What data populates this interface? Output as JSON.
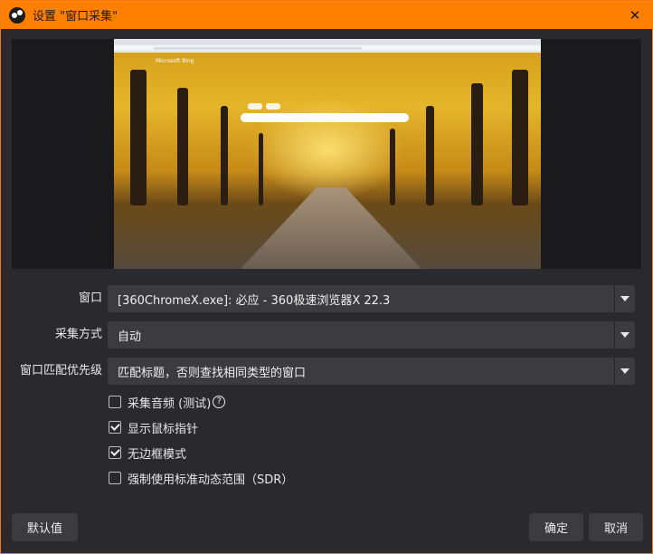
{
  "window": {
    "title": "设置 \"窗口采集\"",
    "close_glyph": "✕",
    "accent": "#ff7f00",
    "background": "#2a2a2e",
    "app_icon": "obs-icon"
  },
  "preview": {
    "browser_brand": "Microsoft Bing"
  },
  "fields": {
    "window": {
      "label": "窗口",
      "value": "[360ChromeX.exe]: 必应 - 360极速浏览器X 22.3"
    },
    "capture_method": {
      "label": "采集方式",
      "value": "自动"
    },
    "match_priority": {
      "label": "窗口匹配优先级",
      "value": "匹配标题，否则查找相同类型的窗口"
    }
  },
  "checkboxes": [
    {
      "label": "采集音频 (测试)",
      "checked": false,
      "help": "?"
    },
    {
      "label": "显示鼠标指针",
      "checked": true
    },
    {
      "label": "无边框模式",
      "checked": true
    },
    {
      "label": "强制使用标准动态范围（SDR）",
      "checked": false
    }
  ],
  "buttons": {
    "defaults": "默认值",
    "ok": "确定",
    "cancel": "取消"
  }
}
